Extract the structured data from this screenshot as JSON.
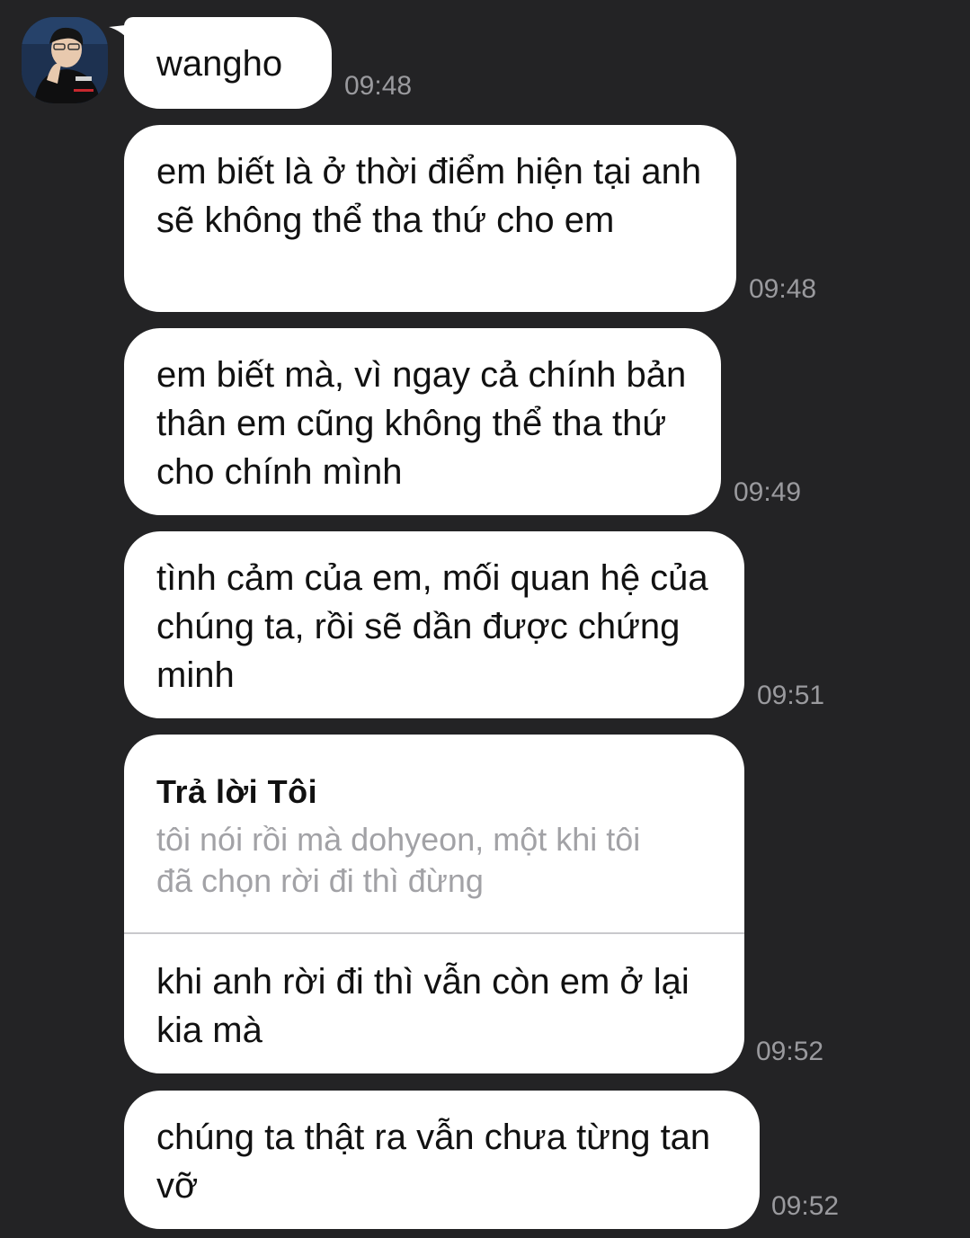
{
  "conversation": {
    "sender_avatar": "avatar-photo",
    "messages": [
      {
        "text": "wangho",
        "time": "09:48"
      },
      {
        "text": "em biết là ở thời điểm hiện tại anh sẽ không thể tha thứ cho em",
        "time": "09:48"
      },
      {
        "text": "em biết mà, vì ngay cả chính bản thân em cũng không thể tha thứ cho chính mình",
        "time": "09:49"
      },
      {
        "text": "tình cảm của em, mối quan hệ của chúng ta, rồi sẽ dần được chứng minh",
        "time": "09:51"
      },
      {
        "reply_label": "Trả lời Tôi",
        "quoted_text": "tôi nói rồi mà dohyeon, một khi tôi đã chọn rời đi thì đừng",
        "text": "khi anh rời đi thì vẫn còn em ở lại kia mà",
        "time": "09:52"
      },
      {
        "text": "chúng ta thật ra vẫn chưa từng tan vỡ",
        "time": "09:52"
      }
    ]
  },
  "colors": {
    "background": "#232325",
    "bubble": "#ffffff",
    "timestamp": "#9a9a9e",
    "quote_text": "#a2a2a6"
  }
}
